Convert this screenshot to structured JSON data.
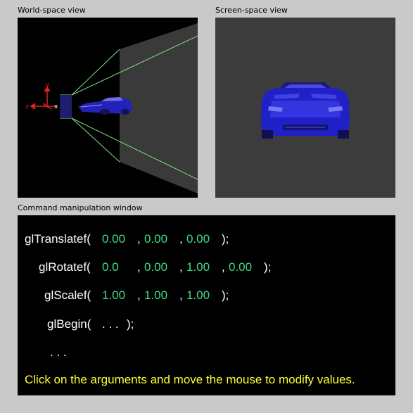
{
  "labels": {
    "world": "World-space view",
    "screen": "Screen-space view",
    "command": "Command manipulation window"
  },
  "axes": {
    "y": "y",
    "z": "z",
    "x": "x"
  },
  "commands": {
    "translate": {
      "name": "glTranslatef(",
      "args": [
        "0.00",
        "0.00",
        "0.00"
      ],
      "close": ");"
    },
    "rotate": {
      "name": "glRotatef(",
      "args": [
        "0.0",
        "0.00",
        "1.00",
        "0.00"
      ],
      "close": ");"
    },
    "scale": {
      "name": "glScalef(",
      "args": [
        "1.00",
        "1.00",
        "1.00"
      ],
      "close": ");"
    },
    "begin": {
      "name": "glBegin(",
      "args_text": ". . .",
      "close": ");"
    },
    "ellipsis": ". . ."
  },
  "hint": "Click on the arguments and move the mouse to modify values.",
  "colors": {
    "background": "#c9c9c9",
    "arg": "#3ddc84",
    "hint": "#ffff33",
    "frustum": "#7fe07f",
    "car": "#2a2ad8"
  },
  "icons": {
    "axes": "axis-gizmo-icon",
    "car": "car-model-icon"
  }
}
